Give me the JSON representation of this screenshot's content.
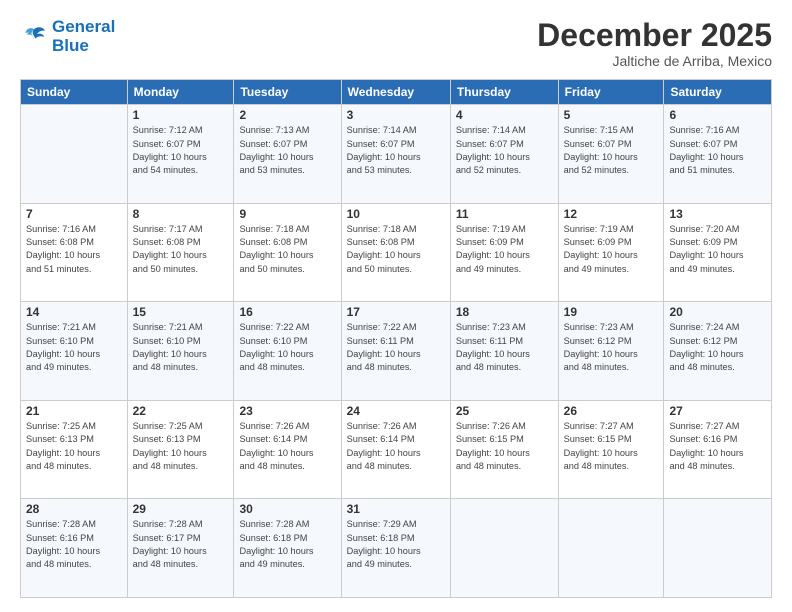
{
  "header": {
    "logo_line1": "General",
    "logo_line2": "Blue",
    "title": "December 2025",
    "subtitle": "Jaltiche de Arriba, Mexico"
  },
  "columns": [
    "Sunday",
    "Monday",
    "Tuesday",
    "Wednesday",
    "Thursday",
    "Friday",
    "Saturday"
  ],
  "weeks": [
    [
      {
        "day": "",
        "info": ""
      },
      {
        "day": "1",
        "info": "Sunrise: 7:12 AM\nSunset: 6:07 PM\nDaylight: 10 hours\nand 54 minutes."
      },
      {
        "day": "2",
        "info": "Sunrise: 7:13 AM\nSunset: 6:07 PM\nDaylight: 10 hours\nand 53 minutes."
      },
      {
        "day": "3",
        "info": "Sunrise: 7:14 AM\nSunset: 6:07 PM\nDaylight: 10 hours\nand 53 minutes."
      },
      {
        "day": "4",
        "info": "Sunrise: 7:14 AM\nSunset: 6:07 PM\nDaylight: 10 hours\nand 52 minutes."
      },
      {
        "day": "5",
        "info": "Sunrise: 7:15 AM\nSunset: 6:07 PM\nDaylight: 10 hours\nand 52 minutes."
      },
      {
        "day": "6",
        "info": "Sunrise: 7:16 AM\nSunset: 6:07 PM\nDaylight: 10 hours\nand 51 minutes."
      }
    ],
    [
      {
        "day": "7",
        "info": "Sunrise: 7:16 AM\nSunset: 6:08 PM\nDaylight: 10 hours\nand 51 minutes."
      },
      {
        "day": "8",
        "info": "Sunrise: 7:17 AM\nSunset: 6:08 PM\nDaylight: 10 hours\nand 50 minutes."
      },
      {
        "day": "9",
        "info": "Sunrise: 7:18 AM\nSunset: 6:08 PM\nDaylight: 10 hours\nand 50 minutes."
      },
      {
        "day": "10",
        "info": "Sunrise: 7:18 AM\nSunset: 6:08 PM\nDaylight: 10 hours\nand 50 minutes."
      },
      {
        "day": "11",
        "info": "Sunrise: 7:19 AM\nSunset: 6:09 PM\nDaylight: 10 hours\nand 49 minutes."
      },
      {
        "day": "12",
        "info": "Sunrise: 7:19 AM\nSunset: 6:09 PM\nDaylight: 10 hours\nand 49 minutes."
      },
      {
        "day": "13",
        "info": "Sunrise: 7:20 AM\nSunset: 6:09 PM\nDaylight: 10 hours\nand 49 minutes."
      }
    ],
    [
      {
        "day": "14",
        "info": "Sunrise: 7:21 AM\nSunset: 6:10 PM\nDaylight: 10 hours\nand 49 minutes."
      },
      {
        "day": "15",
        "info": "Sunrise: 7:21 AM\nSunset: 6:10 PM\nDaylight: 10 hours\nand 48 minutes."
      },
      {
        "day": "16",
        "info": "Sunrise: 7:22 AM\nSunset: 6:10 PM\nDaylight: 10 hours\nand 48 minutes."
      },
      {
        "day": "17",
        "info": "Sunrise: 7:22 AM\nSunset: 6:11 PM\nDaylight: 10 hours\nand 48 minutes."
      },
      {
        "day": "18",
        "info": "Sunrise: 7:23 AM\nSunset: 6:11 PM\nDaylight: 10 hours\nand 48 minutes."
      },
      {
        "day": "19",
        "info": "Sunrise: 7:23 AM\nSunset: 6:12 PM\nDaylight: 10 hours\nand 48 minutes."
      },
      {
        "day": "20",
        "info": "Sunrise: 7:24 AM\nSunset: 6:12 PM\nDaylight: 10 hours\nand 48 minutes."
      }
    ],
    [
      {
        "day": "21",
        "info": "Sunrise: 7:25 AM\nSunset: 6:13 PM\nDaylight: 10 hours\nand 48 minutes."
      },
      {
        "day": "22",
        "info": "Sunrise: 7:25 AM\nSunset: 6:13 PM\nDaylight: 10 hours\nand 48 minutes."
      },
      {
        "day": "23",
        "info": "Sunrise: 7:26 AM\nSunset: 6:14 PM\nDaylight: 10 hours\nand 48 minutes."
      },
      {
        "day": "24",
        "info": "Sunrise: 7:26 AM\nSunset: 6:14 PM\nDaylight: 10 hours\nand 48 minutes."
      },
      {
        "day": "25",
        "info": "Sunrise: 7:26 AM\nSunset: 6:15 PM\nDaylight: 10 hours\nand 48 minutes."
      },
      {
        "day": "26",
        "info": "Sunrise: 7:27 AM\nSunset: 6:15 PM\nDaylight: 10 hours\nand 48 minutes."
      },
      {
        "day": "27",
        "info": "Sunrise: 7:27 AM\nSunset: 6:16 PM\nDaylight: 10 hours\nand 48 minutes."
      }
    ],
    [
      {
        "day": "28",
        "info": "Sunrise: 7:28 AM\nSunset: 6:16 PM\nDaylight: 10 hours\nand 48 minutes."
      },
      {
        "day": "29",
        "info": "Sunrise: 7:28 AM\nSunset: 6:17 PM\nDaylight: 10 hours\nand 48 minutes."
      },
      {
        "day": "30",
        "info": "Sunrise: 7:28 AM\nSunset: 6:18 PM\nDaylight: 10 hours\nand 49 minutes."
      },
      {
        "day": "31",
        "info": "Sunrise: 7:29 AM\nSunset: 6:18 PM\nDaylight: 10 hours\nand 49 minutes."
      },
      {
        "day": "",
        "info": ""
      },
      {
        "day": "",
        "info": ""
      },
      {
        "day": "",
        "info": ""
      }
    ]
  ]
}
